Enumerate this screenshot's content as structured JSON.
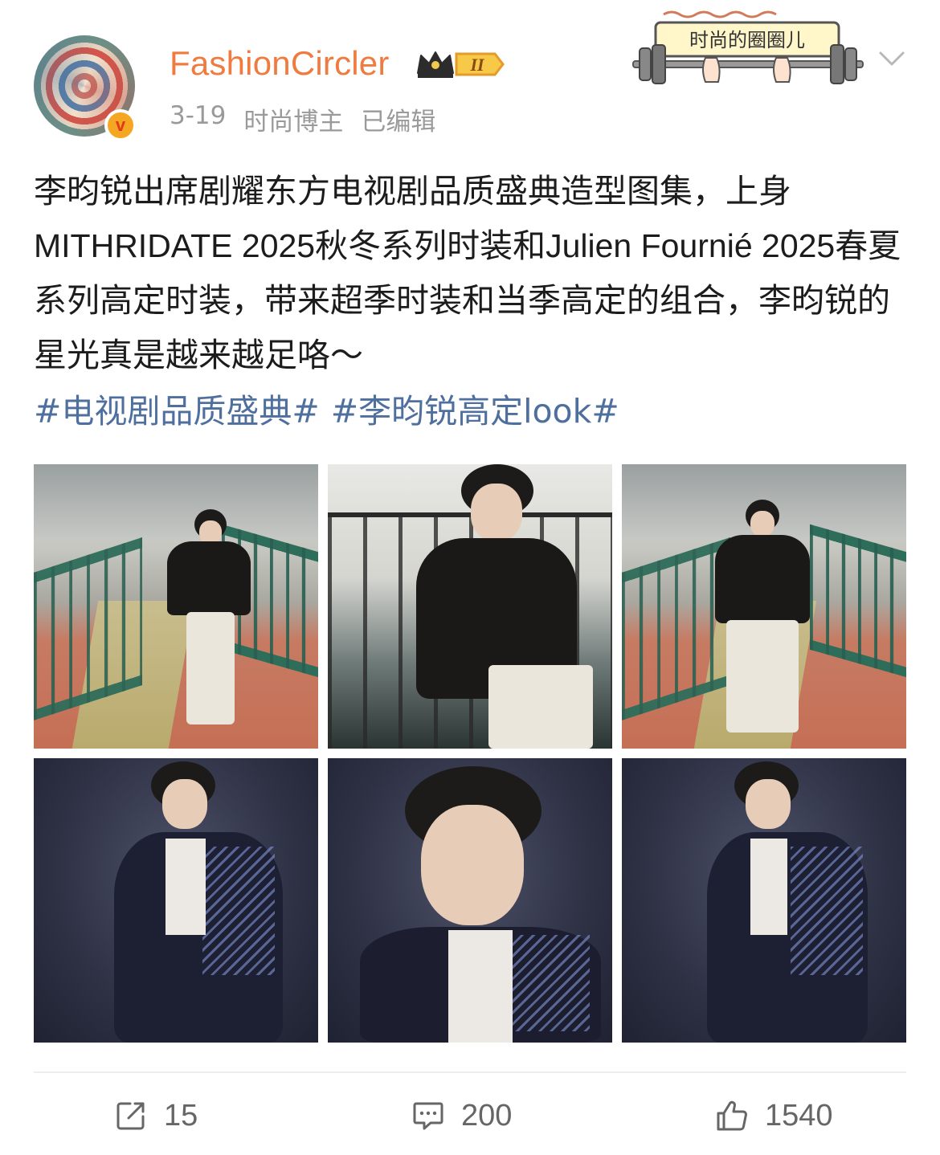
{
  "author": {
    "name": "FashionCircler",
    "verified_mark": "v",
    "vip_level": "II",
    "date": "3-19",
    "role": "时尚博主",
    "edited": "已编辑"
  },
  "sticker": {
    "text": "时尚的圈圈儿"
  },
  "post": {
    "text": "李昀锐出席剧耀东方电视剧品质盛典造型图集，上身MITHRIDATE 2025秋冬系列时装和Julien Fournié 2025春夏系列高定时装，带来超季时装和当季高定的组合，李昀锐的星光真是越来越足咯～",
    "hashtags": [
      "#电视剧品质盛典#",
      "#李昀锐高定look#"
    ]
  },
  "photos": [
    {
      "icon": "photo-bridge-standing"
    },
    {
      "icon": "photo-seated-railing"
    },
    {
      "icon": "photo-bridge-front"
    },
    {
      "icon": "photo-studio-side"
    },
    {
      "icon": "photo-studio-closeup"
    },
    {
      "icon": "photo-studio-side-2"
    }
  ],
  "actions": {
    "share_count": "15",
    "comment_count": "200",
    "like_count": "1540"
  },
  "colors": {
    "username": "#f07b3f",
    "hashtag": "#4f6f9e",
    "meta": "#9a9a9a",
    "action": "#666666"
  }
}
